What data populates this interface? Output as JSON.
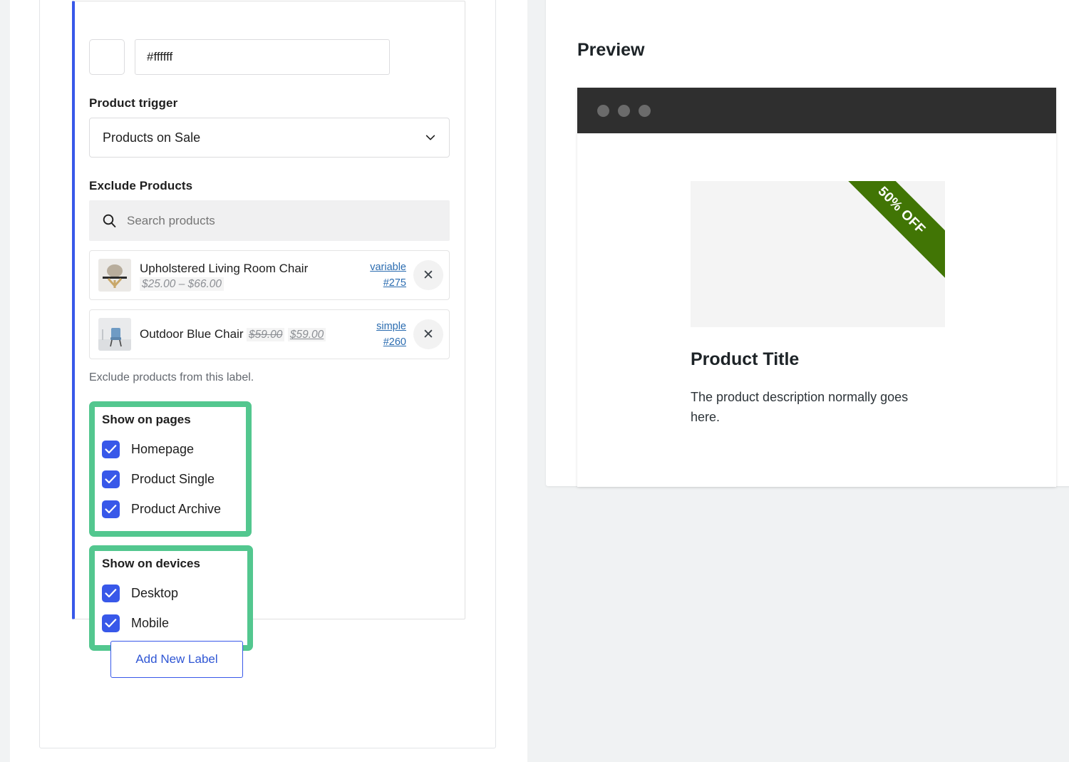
{
  "form": {
    "color": {
      "value": "#ffffff",
      "swatch_color": "#ffffff"
    },
    "product_trigger": {
      "label": "Product trigger",
      "value": "Products on Sale",
      "chevron_icon": "chevron-down-icon"
    },
    "exclude_products": {
      "label": "Exclude Products",
      "search_placeholder": "Search products",
      "search_icon": "search-icon",
      "helper_text": "Exclude products from this label.",
      "items": [
        {
          "name": "Upholstered Living Room Chair",
          "price": "$25.00 – $66.00",
          "price_struck": "",
          "type": "variable",
          "id": "#275",
          "remove_icon": "close-icon",
          "thumb": "armchair-thumbnail"
        },
        {
          "name": "Outdoor Blue Chair",
          "price": "$59.00",
          "price_struck": "$59.00",
          "type": "simple",
          "id": "#260",
          "remove_icon": "close-icon",
          "thumb": "blue-chair-thumbnail"
        }
      ]
    },
    "show_on_pages": {
      "title": "Show on pages",
      "options": [
        {
          "label": "Homepage",
          "checked": true
        },
        {
          "label": "Product Single",
          "checked": true
        },
        {
          "label": "Product Archive",
          "checked": true
        }
      ]
    },
    "show_on_devices": {
      "title": "Show on devices",
      "options": [
        {
          "label": "Desktop",
          "checked": true
        },
        {
          "label": "Mobile",
          "checked": true
        }
      ]
    },
    "add_new_label_button": "Add New Label"
  },
  "preview": {
    "heading": "Preview",
    "browser_dots": 3,
    "product": {
      "ribbon_text": "50% OFF",
      "title": "Product Title",
      "description": "The product description normally goes here."
    }
  },
  "colors": {
    "accent_blue": "#3858e9",
    "highlight_green": "#53c78f",
    "ribbon_green": "#417505",
    "checkbox_blue": "#3858e9",
    "link_blue": "#2b6cb0",
    "browser_bar": "#2f2f2f"
  }
}
